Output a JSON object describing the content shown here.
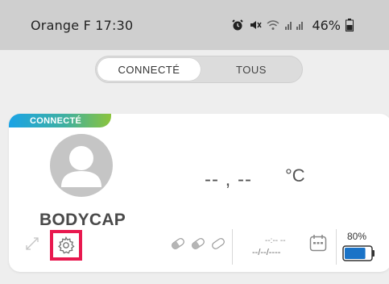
{
  "status_bar": {
    "carrier_time": "Orange F 17:30",
    "battery": "46%"
  },
  "toggle": {
    "active": "CONNECTÉ",
    "inactive": "TOUS"
  },
  "card": {
    "badge": "CONNECTÉ",
    "device_name": "BODYCAP",
    "temperature": "-- , --",
    "unit": "°C",
    "last_time": "--:-- --",
    "last_date": "--/--/----",
    "battery_percent": "80%",
    "battery_level": 0.8
  },
  "colors": {
    "highlight": "#e8194f",
    "battery_fill": "#1a73c7",
    "battery_outline": "#333333",
    "badge_gradient": [
      "#1aa3e6",
      "#8cc43c"
    ]
  },
  "icons": [
    "alarm-icon",
    "mute-icon",
    "wifi-icon",
    "signal-icon",
    "battery-icon",
    "avatar-icon",
    "expand-icon",
    "gear-icon",
    "pill-icon",
    "calendar-icon"
  ]
}
